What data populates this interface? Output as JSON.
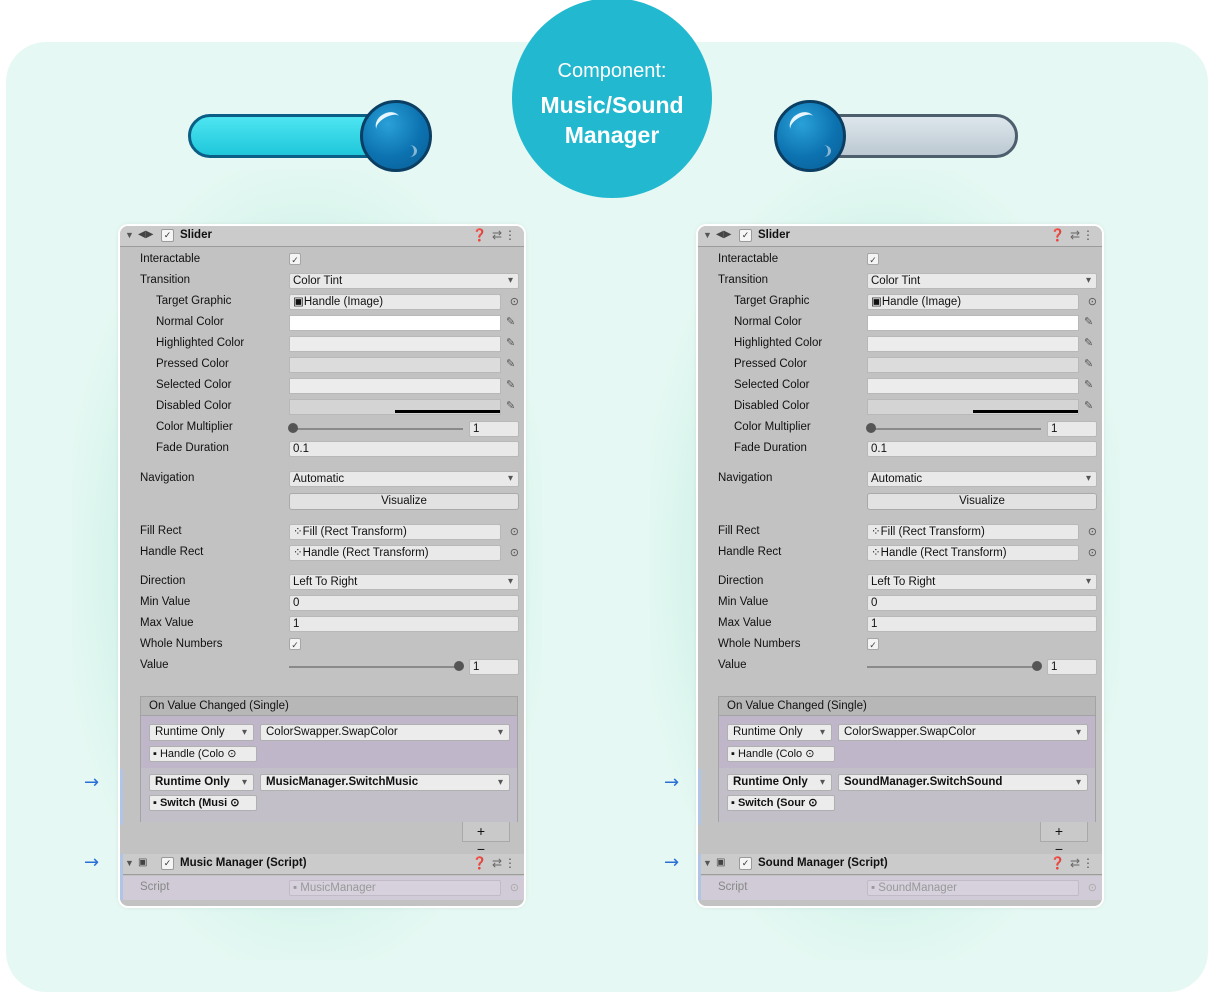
{
  "badge": {
    "line1": "Component:",
    "line2": "Music/Sound Manager"
  },
  "colors": {
    "badge": "#22b8cf",
    "toggle_on": "#2ed4e4",
    "toggle_off": "#c6d2da",
    "knob": "#0c72b0",
    "background": "#e6f8f3",
    "arrow": "#2b6fd6"
  },
  "arrow_glyph": "→",
  "panels": [
    {
      "header_title": "Slider",
      "interactable_label": "Interactable",
      "transition_label": "Transition",
      "transition_value": "Color Tint",
      "target_graphic_label": "Target Graphic",
      "target_graphic_value": "Handle (Image)",
      "normal_color_label": "Normal Color",
      "highlighted_color_label": "Highlighted Color",
      "pressed_color_label": "Pressed Color",
      "selected_color_label": "Selected Color",
      "disabled_color_label": "Disabled Color",
      "color_multiplier_label": "Color Multiplier",
      "color_multiplier_value": "1",
      "fade_duration_label": "Fade Duration",
      "fade_duration_value": "0.1",
      "navigation_label": "Navigation",
      "navigation_value": "Automatic",
      "visualize_label": "Visualize",
      "fill_rect_label": "Fill Rect",
      "fill_rect_value": "Fill (Rect Transform)",
      "handle_rect_label": "Handle Rect",
      "handle_rect_value": "Handle (Rect Transform)",
      "direction_label": "Direction",
      "direction_value": "Left To Right",
      "min_value_label": "Min Value",
      "min_value": "0",
      "max_value_label": "Max Value",
      "max_value": "1",
      "whole_numbers_label": "Whole Numbers",
      "value_label": "Value",
      "value": "1",
      "event_header": "On Value Changed (Single)",
      "event1_mode": "Runtime Only",
      "event1_function": "ColorSwapper.SwapColor",
      "event1_object": "Handle (Colo",
      "event2_mode": "Runtime Only",
      "event2_function": "MusicManager.SwitchMusic",
      "event2_object": "Switch (Musi",
      "plus_minus": "+ −",
      "script_header": "Music Manager (Script)",
      "script_label": "Script",
      "script_value": "MusicManager"
    },
    {
      "header_title": "Slider",
      "interactable_label": "Interactable",
      "transition_label": "Transition",
      "transition_value": "Color Tint",
      "target_graphic_label": "Target Graphic",
      "target_graphic_value": "Handle (Image)",
      "normal_color_label": "Normal Color",
      "highlighted_color_label": "Highlighted Color",
      "pressed_color_label": "Pressed Color",
      "selected_color_label": "Selected Color",
      "disabled_color_label": "Disabled Color",
      "color_multiplier_label": "Color Multiplier",
      "color_multiplier_value": "1",
      "fade_duration_label": "Fade Duration",
      "fade_duration_value": "0.1",
      "navigation_label": "Navigation",
      "navigation_value": "Automatic",
      "visualize_label": "Visualize",
      "fill_rect_label": "Fill Rect",
      "fill_rect_value": "Fill (Rect Transform)",
      "handle_rect_label": "Handle Rect",
      "handle_rect_value": "Handle (Rect Transform)",
      "direction_label": "Direction",
      "direction_value": "Left To Right",
      "min_value_label": "Min Value",
      "min_value": "0",
      "max_value_label": "Max Value",
      "max_value": "1",
      "whole_numbers_label": "Whole Numbers",
      "value_label": "Value",
      "value": "1",
      "event_header": "On Value Changed (Single)",
      "event1_mode": "Runtime Only",
      "event1_function": "ColorSwapper.SwapColor",
      "event1_object": "Handle (Colo",
      "event2_mode": "Runtime Only",
      "event2_function": "SoundManager.SwitchSound",
      "event2_object": "Switch (Sour",
      "plus_minus": "+ −",
      "script_header": "Sound Manager (Script)",
      "script_label": "Script",
      "script_value": "SoundManager"
    }
  ]
}
